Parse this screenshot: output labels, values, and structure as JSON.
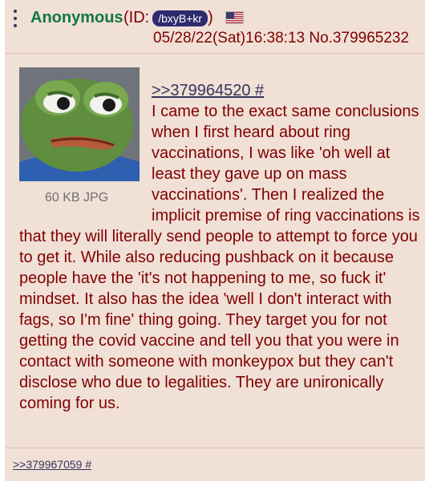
{
  "post": {
    "name": "Anonymous",
    "id_prefix": "(ID: ",
    "id_value": "/bxyB+kr",
    "id_suffix": ")",
    "flag_icon": "us-flag-icon",
    "datetime": "05/28/22(Sat)16:38:13 No.379965232",
    "file_info": "60 KB JPG",
    "quote_link": ">>379964520 #",
    "body": "I came to the exact same conclusions when I first heard about ring vaccinations, I was like 'oh well at least they gave up on mass vaccinations'. Then I realized the implicit premise of ring vaccinations is that they will literally send people to attempt to force you to get it. While also reducing pushback on it because people have the 'it's not happening to me, so fuck it' mindset. It also has the idea 'well I don't interact with fags, so I'm fine' thing going. They target you for not getting the covid vaccine and tell you that you were in contact with someone with monkeypox but they can't disclose who due to legalities. They are unironically coming for us.",
    "reply_link": ">>379967059 #"
  },
  "colors": {
    "background": "#f0e0d6",
    "name": "#117743",
    "text": "#800000",
    "link": "#34345c",
    "id_badge": "#2d2a6e"
  }
}
